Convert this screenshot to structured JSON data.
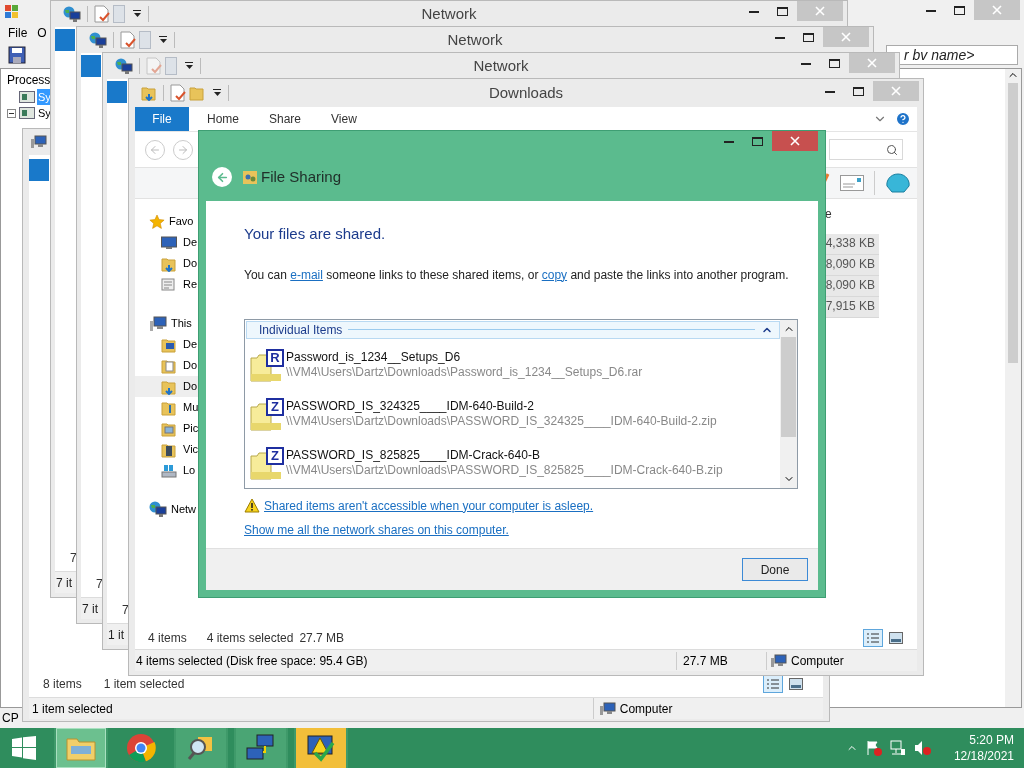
{
  "background_window": {
    "menu": [
      "File",
      "O"
    ],
    "tree_header": "Process",
    "tree_items": [
      {
        "label": "Sy",
        "selected": true,
        "expandable": false
      },
      {
        "label": "Sy",
        "selected": false,
        "expandable": true
      }
    ],
    "filter": "r bv name>",
    "footer": "CP"
  },
  "back_window": {
    "status_count": "8 items",
    "status_selected": "1 item selected",
    "footer": "1 item selected",
    "location": "Computer"
  },
  "network_windows": [
    {
      "title": "Network",
      "status": "7",
      "footer": "7 it",
      "faded_icon": false
    },
    {
      "title": "Network",
      "status": "7",
      "footer": "7 it",
      "faded_icon": false
    },
    {
      "title": "Network",
      "status": "7",
      "footer": "1 it",
      "faded_icon": true
    }
  ],
  "explorer": {
    "title": "Downloads",
    "ribbon_tabs": [
      {
        "label": "File",
        "selected": true
      },
      {
        "label": "Home",
        "selected": false
      },
      {
        "label": "Share",
        "selected": false
      },
      {
        "label": "View",
        "selected": false
      }
    ],
    "nav_pane": [
      {
        "label": "Favo",
        "kind": "favorites",
        "selected": false,
        "children": [
          {
            "label": "De",
            "kind": "desktop",
            "selected": false
          },
          {
            "label": "Do",
            "kind": "downloads",
            "selected": false
          },
          {
            "label": "Re",
            "kind": "recent",
            "selected": false
          }
        ]
      },
      {
        "label": "This",
        "kind": "computer",
        "selected": false,
        "children": [
          {
            "label": "De",
            "kind": "desktop_folder",
            "selected": false
          },
          {
            "label": "Do",
            "kind": "documents",
            "selected": false
          },
          {
            "label": "Do",
            "kind": "downloads",
            "selected": true
          },
          {
            "label": "Mu",
            "kind": "music",
            "selected": false
          },
          {
            "label": "Pic",
            "kind": "pictures",
            "selected": false
          },
          {
            "label": "Vic",
            "kind": "videos",
            "selected": false
          },
          {
            "label": "Lo",
            "kind": "disk",
            "selected": false
          }
        ]
      },
      {
        "label": "Netw",
        "kind": "network",
        "selected": false
      }
    ],
    "size_header": "e",
    "sizes": [
      "4,338 KB",
      "8,090 KB",
      "8,090 KB",
      "7,915 KB"
    ],
    "status_count": "4 items",
    "status_selected": "4 items selected",
    "status_size": "27.7 MB",
    "footer_text": "4 items selected (Disk free space: 95.4 GB)",
    "footer_size": "27.7 MB",
    "footer_location": "Computer"
  },
  "dialog": {
    "title": "File Sharing",
    "heading": "Your files are shared.",
    "intro": [
      {
        "kind": "text",
        "text": "You can "
      },
      {
        "kind": "link",
        "text": "e-mail"
      },
      {
        "kind": "text",
        "text": " someone links to these shared items, or "
      },
      {
        "kind": "link",
        "text": "copy"
      },
      {
        "kind": "text",
        "text": " and paste the links into another program."
      }
    ],
    "group_label": "Individual Items",
    "group_expanded": true,
    "items": [
      {
        "name": "Password_is_1234__Setups_D6",
        "path": "\\\\VM4\\Users\\Dartz\\Downloads\\Password_is_1234__Setups_D6.rar",
        "badge": "R"
      },
      {
        "name": "PASSWORD_IS_324325____IDM-640-Build-2",
        "path": "\\\\VM4\\Users\\Dartz\\Downloads\\PASSWORD_IS_324325____IDM-640-Build-2.zip",
        "badge": "Z"
      },
      {
        "name": "PASSWORD_IS_825825____IDM-Crack-640-B",
        "path": "\\\\VM4\\Users\\Dartz\\Downloads\\PASSWORD_IS_825825____IDM-Crack-640-B.zip",
        "badge": "Z"
      }
    ],
    "warning_link": "Shared items aren't accessible when your computer is asleep.",
    "shares_link": "Show me all the network shares on this computer.",
    "button": "Done"
  },
  "taskbar": {
    "apps": [
      {
        "kind": "explorer",
        "selected": true,
        "running": true,
        "attention": false
      },
      {
        "kind": "chrome",
        "selected": false,
        "running": false,
        "attention": false
      },
      {
        "kind": "control_panel",
        "selected": false,
        "running": true,
        "attention": false
      },
      {
        "kind": "network",
        "selected": false,
        "running": true,
        "attention": false
      },
      {
        "kind": "security",
        "selected": false,
        "running": true,
        "attention": true
      }
    ],
    "time": "5:20 PM",
    "date": "12/18/2021"
  }
}
